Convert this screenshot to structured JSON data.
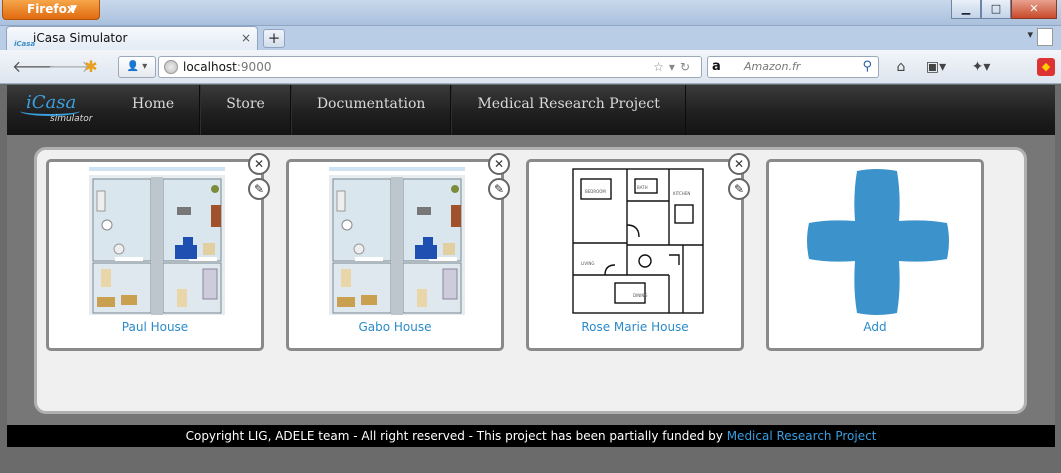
{
  "browser": {
    "menu_button": "Firefox",
    "tab_title": "iCasa Simulator",
    "tab_favicon_text": "iCasa",
    "url_host": "localhost",
    "url_port": ":9000",
    "search_engine": "a",
    "search_placeholder": "Amazon.fr"
  },
  "app": {
    "logo_text": "iCasa",
    "logo_sub": "simulator",
    "menu": [
      "Home",
      "Store",
      "Documentation",
      "Medical Research Project"
    ]
  },
  "houses": [
    {
      "label": "Paul House",
      "thumb": "apartment-3d"
    },
    {
      "label": "Gabo House",
      "thumb": "apartment-3d"
    },
    {
      "label": "Rose Marie House",
      "thumb": "floor-plan"
    },
    {
      "label": "Add",
      "thumb": "plus"
    }
  ],
  "footer": {
    "text": "Copyright LIG, ADELE team - All right reserved - This project has been partially funded by ",
    "link": "Medical Research Project"
  },
  "colors": {
    "accent": "#2b8ac8",
    "plus_blue": "#3c93cc",
    "header_dark": "#1e1e1e"
  }
}
